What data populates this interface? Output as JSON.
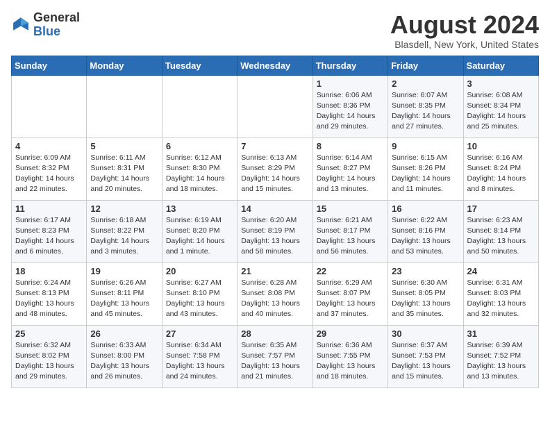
{
  "logo": {
    "general": "General",
    "blue": "Blue"
  },
  "title": {
    "month_year": "August 2024",
    "location": "Blasdell, New York, United States"
  },
  "days_of_week": [
    "Sunday",
    "Monday",
    "Tuesday",
    "Wednesday",
    "Thursday",
    "Friday",
    "Saturday"
  ],
  "weeks": [
    [
      {
        "day": "",
        "info": ""
      },
      {
        "day": "",
        "info": ""
      },
      {
        "day": "",
        "info": ""
      },
      {
        "day": "",
        "info": ""
      },
      {
        "day": "1",
        "info": "Sunrise: 6:06 AM\nSunset: 8:36 PM\nDaylight: 14 hours\nand 29 minutes."
      },
      {
        "day": "2",
        "info": "Sunrise: 6:07 AM\nSunset: 8:35 PM\nDaylight: 14 hours\nand 27 minutes."
      },
      {
        "day": "3",
        "info": "Sunrise: 6:08 AM\nSunset: 8:34 PM\nDaylight: 14 hours\nand 25 minutes."
      }
    ],
    [
      {
        "day": "4",
        "info": "Sunrise: 6:09 AM\nSunset: 8:32 PM\nDaylight: 14 hours\nand 22 minutes."
      },
      {
        "day": "5",
        "info": "Sunrise: 6:11 AM\nSunset: 8:31 PM\nDaylight: 14 hours\nand 20 minutes."
      },
      {
        "day": "6",
        "info": "Sunrise: 6:12 AM\nSunset: 8:30 PM\nDaylight: 14 hours\nand 18 minutes."
      },
      {
        "day": "7",
        "info": "Sunrise: 6:13 AM\nSunset: 8:29 PM\nDaylight: 14 hours\nand 15 minutes."
      },
      {
        "day": "8",
        "info": "Sunrise: 6:14 AM\nSunset: 8:27 PM\nDaylight: 14 hours\nand 13 minutes."
      },
      {
        "day": "9",
        "info": "Sunrise: 6:15 AM\nSunset: 8:26 PM\nDaylight: 14 hours\nand 11 minutes."
      },
      {
        "day": "10",
        "info": "Sunrise: 6:16 AM\nSunset: 8:24 PM\nDaylight: 14 hours\nand 8 minutes."
      }
    ],
    [
      {
        "day": "11",
        "info": "Sunrise: 6:17 AM\nSunset: 8:23 PM\nDaylight: 14 hours\nand 6 minutes."
      },
      {
        "day": "12",
        "info": "Sunrise: 6:18 AM\nSunset: 8:22 PM\nDaylight: 14 hours\nand 3 minutes."
      },
      {
        "day": "13",
        "info": "Sunrise: 6:19 AM\nSunset: 8:20 PM\nDaylight: 14 hours\nand 1 minute."
      },
      {
        "day": "14",
        "info": "Sunrise: 6:20 AM\nSunset: 8:19 PM\nDaylight: 13 hours\nand 58 minutes."
      },
      {
        "day": "15",
        "info": "Sunrise: 6:21 AM\nSunset: 8:17 PM\nDaylight: 13 hours\nand 56 minutes."
      },
      {
        "day": "16",
        "info": "Sunrise: 6:22 AM\nSunset: 8:16 PM\nDaylight: 13 hours\nand 53 minutes."
      },
      {
        "day": "17",
        "info": "Sunrise: 6:23 AM\nSunset: 8:14 PM\nDaylight: 13 hours\nand 50 minutes."
      }
    ],
    [
      {
        "day": "18",
        "info": "Sunrise: 6:24 AM\nSunset: 8:13 PM\nDaylight: 13 hours\nand 48 minutes."
      },
      {
        "day": "19",
        "info": "Sunrise: 6:26 AM\nSunset: 8:11 PM\nDaylight: 13 hours\nand 45 minutes."
      },
      {
        "day": "20",
        "info": "Sunrise: 6:27 AM\nSunset: 8:10 PM\nDaylight: 13 hours\nand 43 minutes."
      },
      {
        "day": "21",
        "info": "Sunrise: 6:28 AM\nSunset: 8:08 PM\nDaylight: 13 hours\nand 40 minutes."
      },
      {
        "day": "22",
        "info": "Sunrise: 6:29 AM\nSunset: 8:07 PM\nDaylight: 13 hours\nand 37 minutes."
      },
      {
        "day": "23",
        "info": "Sunrise: 6:30 AM\nSunset: 8:05 PM\nDaylight: 13 hours\nand 35 minutes."
      },
      {
        "day": "24",
        "info": "Sunrise: 6:31 AM\nSunset: 8:03 PM\nDaylight: 13 hours\nand 32 minutes."
      }
    ],
    [
      {
        "day": "25",
        "info": "Sunrise: 6:32 AM\nSunset: 8:02 PM\nDaylight: 13 hours\nand 29 minutes."
      },
      {
        "day": "26",
        "info": "Sunrise: 6:33 AM\nSunset: 8:00 PM\nDaylight: 13 hours\nand 26 minutes."
      },
      {
        "day": "27",
        "info": "Sunrise: 6:34 AM\nSunset: 7:58 PM\nDaylight: 13 hours\nand 24 minutes."
      },
      {
        "day": "28",
        "info": "Sunrise: 6:35 AM\nSunset: 7:57 PM\nDaylight: 13 hours\nand 21 minutes."
      },
      {
        "day": "29",
        "info": "Sunrise: 6:36 AM\nSunset: 7:55 PM\nDaylight: 13 hours\nand 18 minutes."
      },
      {
        "day": "30",
        "info": "Sunrise: 6:37 AM\nSunset: 7:53 PM\nDaylight: 13 hours\nand 15 minutes."
      },
      {
        "day": "31",
        "info": "Sunrise: 6:39 AM\nSunset: 7:52 PM\nDaylight: 13 hours\nand 13 minutes."
      }
    ]
  ]
}
